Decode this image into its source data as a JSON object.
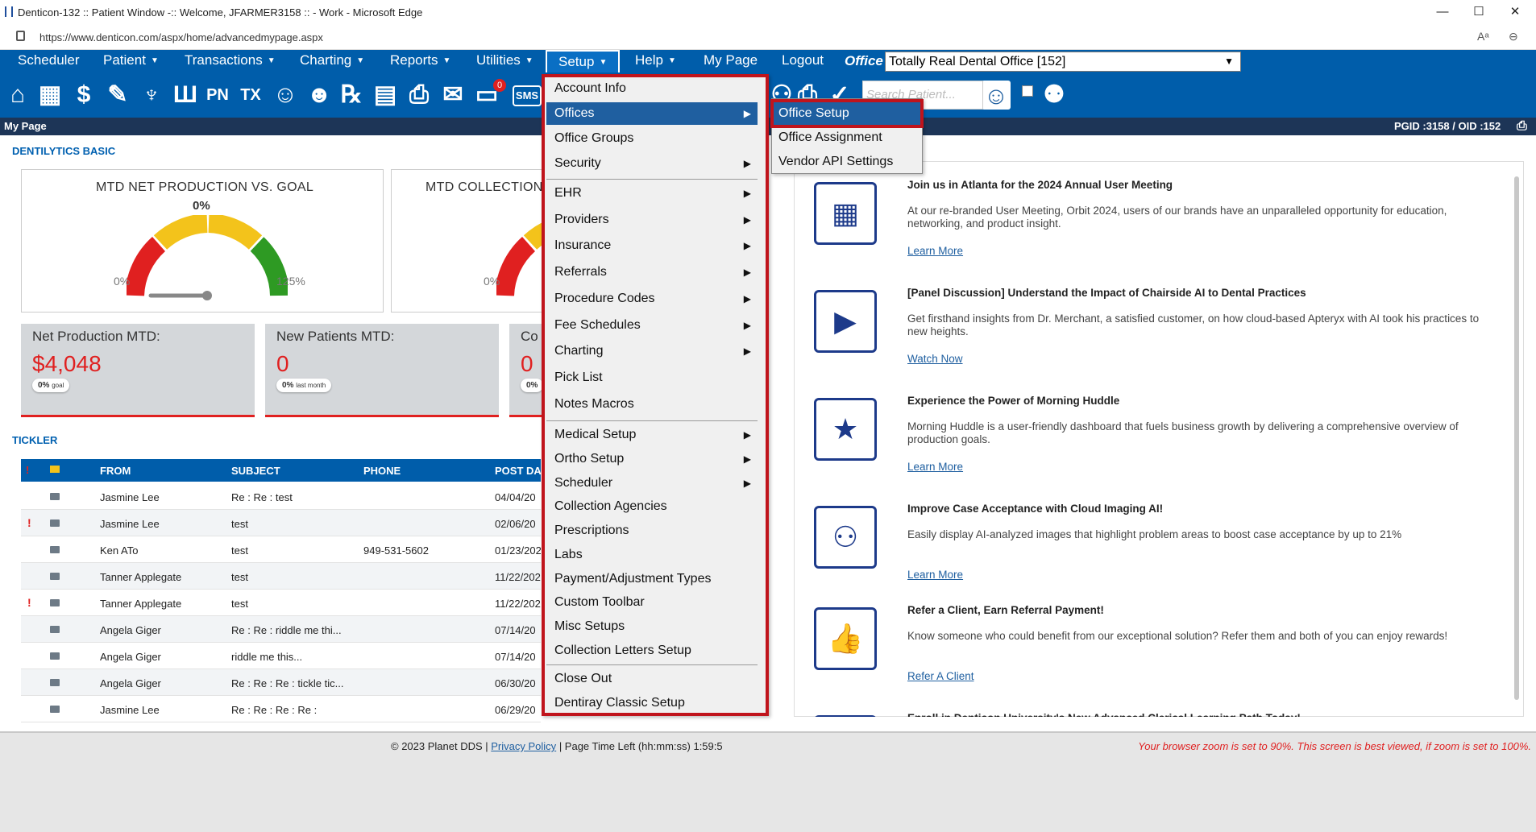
{
  "browser": {
    "title": "Denticon-132 :: Patient Window -:: Welcome, JFARMER3158 :: - Work - Microsoft Edge",
    "url": "https://www.denticon.com/aspx/home/advancedmypage.aspx",
    "minimize": "—",
    "maximize": "☐",
    "close": "✕"
  },
  "nav": {
    "items": [
      {
        "label": "Scheduler"
      },
      {
        "label": "Patient"
      },
      {
        "label": "Transactions"
      },
      {
        "label": "Charting"
      },
      {
        "label": "Reports"
      },
      {
        "label": "Utilities"
      },
      {
        "label": "Setup"
      },
      {
        "label": "Help"
      },
      {
        "label": "My Page"
      },
      {
        "label": "Logout"
      }
    ],
    "caret": "▼",
    "office_label": "Office",
    "office_value": "Totally Real Dental Office [152]"
  },
  "toolbar": {
    "search_placeholder": "Search Patient...",
    "badge": "0",
    "sms": "SMS"
  },
  "mypage": {
    "title": "My Page",
    "ids": "PGID :3158  /  OID :152"
  },
  "dentilytics": {
    "title": "DENTILYTICS BASIC",
    "gauge1": {
      "title": "MTD NET PRODUCTION VS. GOAL",
      "value": "0%",
      "min": "0%",
      "max": "125%",
      "level": 0
    },
    "gauge2": {
      "title": "MTD COLLECTION",
      "min": "0%"
    },
    "stat1": {
      "label": "Net Production MTD:",
      "value": "$4,048",
      "pill": "0%",
      "pill_sub": "goal"
    },
    "stat2": {
      "label": "New Patients MTD:",
      "value": "0",
      "pill": "0%",
      "pill_sub": "last month"
    },
    "stat3": {
      "label": "Co",
      "value": "0",
      "pill": "0%"
    }
  },
  "tickler": {
    "title": "TICKLER",
    "headers": {
      "from": "FROM",
      "subject": "SUBJECT",
      "phone": "PHONE",
      "post": "POST DA"
    },
    "rows": [
      {
        "flag": "",
        "from": "Jasmine Lee",
        "subject": "Re : Re : test",
        "phone": "",
        "post": "04/04/20"
      },
      {
        "flag": "!",
        "from": "Jasmine Lee",
        "subject": "test",
        "phone": "",
        "post": "02/06/20"
      },
      {
        "flag": "",
        "from": "Ken ATo",
        "subject": "test",
        "phone": "949-531-5602",
        "post": "01/23/202"
      },
      {
        "flag": "",
        "from": "Tanner Applegate",
        "subject": "test",
        "phone": "",
        "post": "11/22/202"
      },
      {
        "flag": "!",
        "from": "Tanner Applegate",
        "subject": "test",
        "phone": "",
        "post": "11/22/202"
      },
      {
        "flag": "",
        "from": "Angela Giger",
        "subject": "Re : Re : riddle me thi...",
        "phone": "",
        "post": "07/14/20"
      },
      {
        "flag": "",
        "from": "Angela Giger",
        "subject": "riddle me this...",
        "phone": "",
        "post": "07/14/20"
      },
      {
        "flag": "",
        "from": "Angela Giger",
        "subject": "Re : Re : Re : tickle tic...",
        "phone": "",
        "post": "06/30/20"
      },
      {
        "flag": "",
        "from": "Jasmine Lee",
        "subject": "Re : Re : Re : Re :",
        "phone": "",
        "post": "06/29/20"
      }
    ]
  },
  "setup_menu": {
    "items": [
      {
        "label": "Account Info",
        "sub": false
      },
      {
        "label": "Offices",
        "sub": true
      },
      {
        "label": "Office Groups",
        "sub": false
      },
      {
        "label": "Security",
        "sub": true
      },
      {
        "label": "EHR",
        "sub": true
      },
      {
        "label": "Providers",
        "sub": true
      },
      {
        "label": "Insurance",
        "sub": true
      },
      {
        "label": "Referrals",
        "sub": true
      },
      {
        "label": "Procedure Codes",
        "sub": true
      },
      {
        "label": "Fee Schedules",
        "sub": true
      },
      {
        "label": "Charting",
        "sub": true
      },
      {
        "label": "Pick List",
        "sub": false
      },
      {
        "label": "Notes Macros",
        "sub": false
      },
      {
        "label": "Medical Setup",
        "sub": true
      },
      {
        "label": "Ortho Setup",
        "sub": true
      },
      {
        "label": "Scheduler",
        "sub": true
      },
      {
        "label": "Collection Agencies",
        "sub": false
      },
      {
        "label": "Prescriptions",
        "sub": false
      },
      {
        "label": "Labs",
        "sub": false
      },
      {
        "label": "Payment/Adjustment Types",
        "sub": false
      },
      {
        "label": "Custom Toolbar",
        "sub": false
      },
      {
        "label": "Misc Setups",
        "sub": false
      },
      {
        "label": "Collection Letters Setup",
        "sub": false
      },
      {
        "label": "Close Out",
        "sub": false
      },
      {
        "label": "Dentiray Classic Setup",
        "sub": false
      }
    ],
    "arrow": "▶"
  },
  "offices_submenu": {
    "items": [
      "Office Setup",
      "Office Assignment",
      "Vendor API Settings"
    ]
  },
  "news": [
    {
      "title": "Join us in Atlanta for the 2024 Annual User Meeting",
      "body": "At our re-branded User Meeting, Orbit 2024, users of our brands have an unparalleled opportunity for education, networking, and product insight.",
      "link": "Learn More"
    },
    {
      "title": "[Panel Discussion] Understand the Impact of Chairside AI to Dental Practices",
      "body": "Get firsthand insights from Dr. Merchant, a satisfied customer, on how cloud-based Apteryx with AI took his practices to new heights.",
      "link": "Watch Now"
    },
    {
      "title": "Experience the Power of Morning Huddle",
      "body": "Morning Huddle is a user-friendly dashboard that fuels business growth by delivering a comprehensive overview of production goals.",
      "link": "Learn More"
    },
    {
      "title": "Improve Case Acceptance with Cloud Imaging AI!",
      "body": "Easily display AI-analyzed images that highlight problem areas to boost case acceptance by up to 21%",
      "link": "Learn More"
    },
    {
      "title": "Refer a Client, Earn Referral Payment!",
      "body": "Know someone who could benefit from our exceptional solution? Refer them and both of you can enjoy rewards!",
      "link": "Refer A Client"
    },
    {
      "title": "Enroll in Denticon University's New Advanced Clerical Learning Path Today!",
      "body": "",
      "link": ""
    }
  ],
  "footer": {
    "copyright": "© 2023 Planet DDS |",
    "privacy": "Privacy Policy",
    "page_time": "| Page Time Left (hh:mm:ss) 1:59:5",
    "zoom_warning": "Your browser zoom is set to 90%. This screen is best viewed, if zoom is set to 100%."
  },
  "colors": {
    "brand": "#005daa",
    "highlight_border": "#c0141c",
    "alert": "#e02020"
  }
}
